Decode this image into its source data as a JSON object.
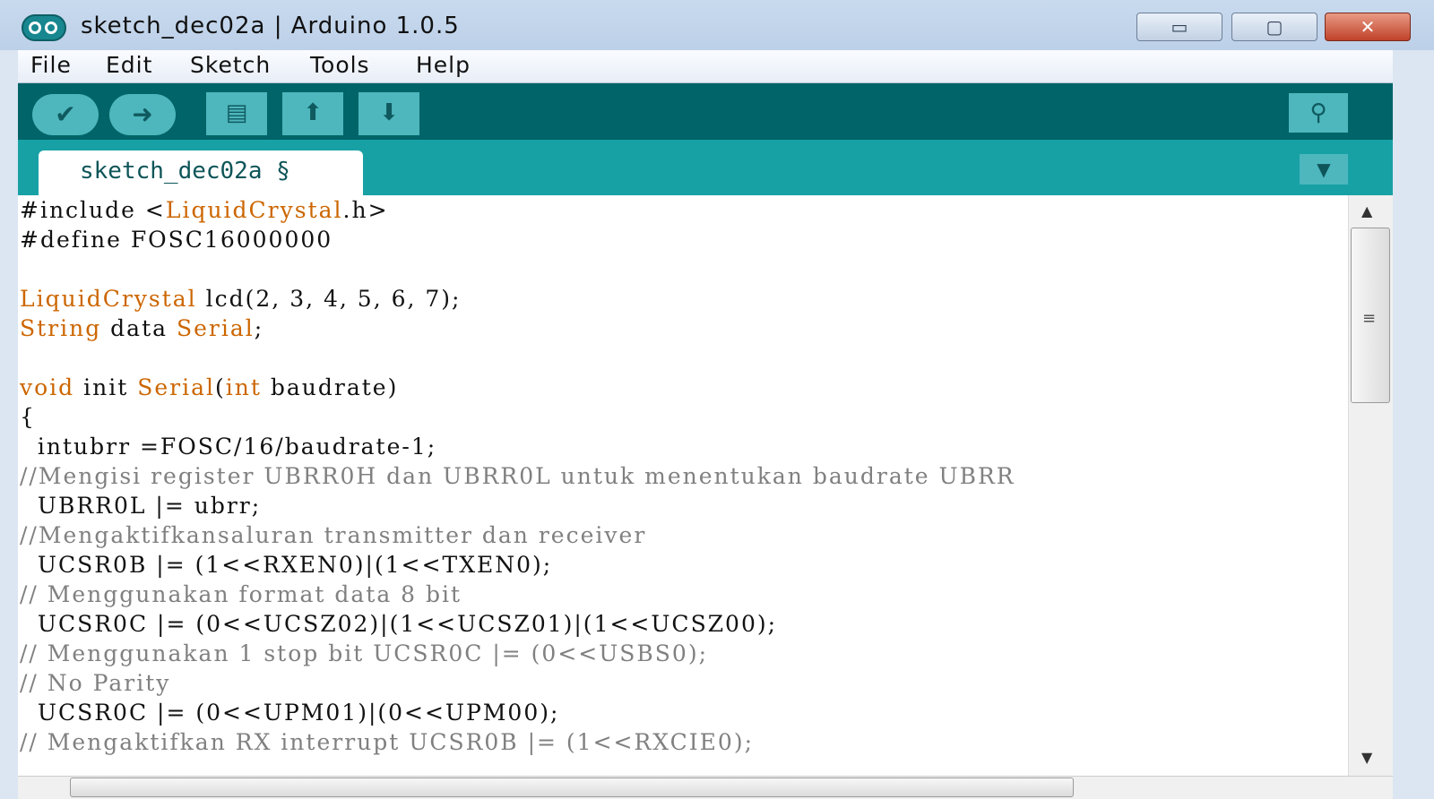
{
  "window": {
    "title": "sketch_dec02a | Arduino 1.0.5",
    "controls": {
      "minimize": "▭",
      "maximize": "▢",
      "close": "✕"
    }
  },
  "menu": {
    "items": [
      "File",
      "Edit",
      "Sketch",
      "Tools",
      "Help"
    ]
  },
  "toolbar": {
    "buttons": [
      {
        "name": "verify",
        "icon": "checkmark-icon",
        "glyph": "✔"
      },
      {
        "name": "upload",
        "icon": "arrow-right-icon",
        "glyph": "➜"
      },
      {
        "name": "new",
        "icon": "document-icon",
        "glyph": "▤"
      },
      {
        "name": "open",
        "icon": "arrow-up-icon",
        "glyph": "⬆"
      },
      {
        "name": "save",
        "icon": "arrow-down-icon",
        "glyph": "⬇"
      }
    ],
    "serial_monitor": {
      "icon": "magnifier-icon",
      "glyph": "⚲"
    }
  },
  "tabs": {
    "active_label": "sketch_dec02a §",
    "menu_glyph": "▼"
  },
  "editor": {
    "lines": [
      "#include <LiquidCrystal.h>",
      "#define FOSC16000000",
      "",
      "LiquidCrystal lcd(2, 3, 4, 5, 6, 7);",
      "String data Serial;",
      "",
      "void init Serial(int baudrate)",
      "{",
      "  intubrr =FOSC/16/baudrate-1;",
      "//Mengisi register UBRR0H dan UBRR0L untuk menentukan baudrate UBRR",
      "  UBRR0L |= ubrr;",
      "//Mengaktifkansaluran transmitter dan receiver",
      "  UCSR0B |= (1<<RXEN0)|(1<<TXEN0);",
      "// Menggunakan format data 8 bit",
      "  UCSR0C |= (0<<UCSZ02)|(1<<UCSZ01)|(1<<UCSZ00);",
      "// Menggunakan 1 stop bit UCSR0C |= (0<<USBS0);",
      "// No Parity",
      "  UCSR0C |= (0<<UPM01)|(0<<UPM00);",
      "// Mengaktifkan RX interrupt UCSR0B |= (1<<RXCIE0);"
    ]
  },
  "colors": {
    "toolbar_bg": "#006468",
    "tabbar_bg": "#17a1a5",
    "button_bg": "#4db7bd",
    "keyword": "#cc6600",
    "comment": "#808080"
  }
}
